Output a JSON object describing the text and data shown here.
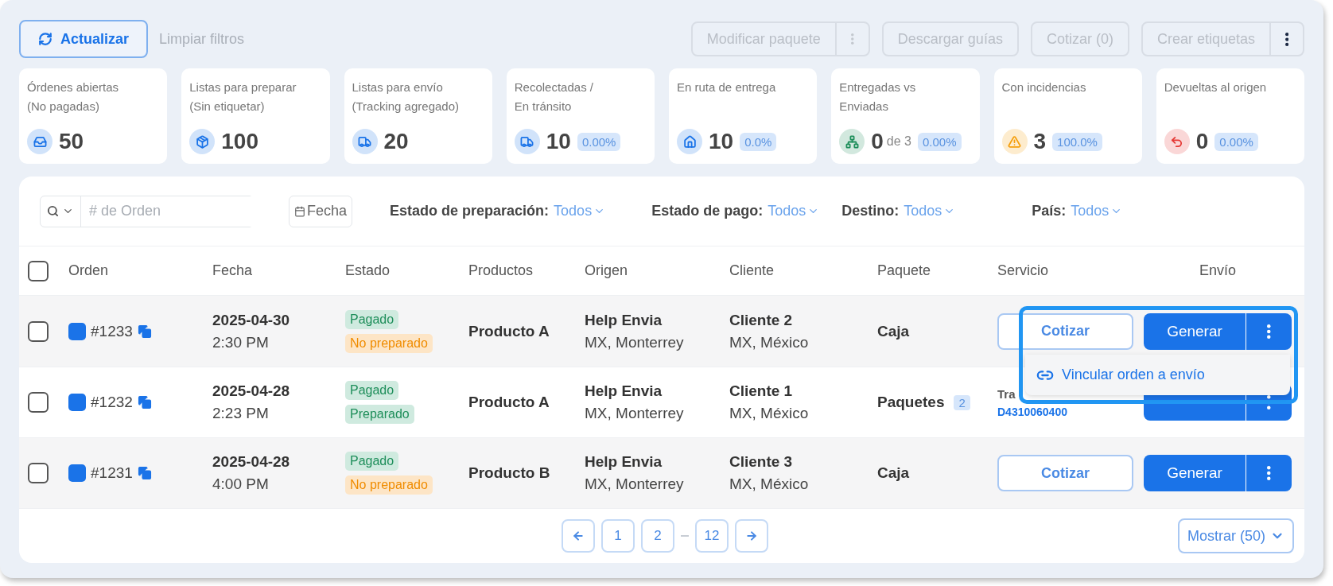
{
  "toolbar": {
    "refresh": "Actualizar",
    "clear": "Limpiar filtros",
    "actions": [
      {
        "label": "Modificar paquete",
        "disabled": true,
        "menu": {
          "disabled": true
        }
      },
      {
        "label": "Descargar guías",
        "disabled": true
      },
      {
        "label": "Cotizar (0)",
        "disabled": true
      },
      {
        "label": "Crear etiquetas",
        "disabled": true,
        "menu": {
          "disabled": false
        }
      }
    ]
  },
  "stats": [
    {
      "lines": [
        "Órdenes abiertas",
        "(No pagadas)"
      ],
      "value": "50",
      "color": "#1a73e8"
    },
    {
      "lines": [
        "Listas para preparar",
        "(Sin etiquetar)"
      ],
      "value": "100",
      "color": "#1a73e8"
    },
    {
      "lines": [
        "Listas para envío",
        "(Tracking agregado)"
      ],
      "value": "20",
      "color": "#1a73e8"
    },
    {
      "lines": [
        "Recolectadas /",
        "En tránsito"
      ],
      "value": "10",
      "badge": "0.00%",
      "color": "#1a73e8"
    },
    {
      "lines": [
        "En ruta de entrega"
      ],
      "value": "10",
      "badge": "0.0%",
      "color": "#1a73e8"
    },
    {
      "lines": [
        "Entregadas vs",
        "Enviadas"
      ],
      "value": "0",
      "of": "de 3",
      "badge": "0.00%",
      "color": "#1e8e5a"
    },
    {
      "lines": [
        "Con incidencias"
      ],
      "value": "3",
      "badge": "100.0%",
      "color": "#f59e0b"
    },
    {
      "lines": [
        "Devueltas al origen"
      ],
      "value": "0",
      "badge": "0.00%",
      "color": "#e53935"
    }
  ],
  "filters": {
    "search_placeholder": "# de Orden",
    "date": "Fecha",
    "selects": [
      {
        "label": "Estado de preparación:",
        "value": "Todos"
      },
      {
        "label": "Estado de pago:",
        "value": "Todos"
      },
      {
        "label": "Destino:",
        "value": "Todos"
      },
      {
        "label": "País:",
        "value": "Todos"
      }
    ]
  },
  "table": {
    "select_all": {
      "checked": false
    },
    "columns": [
      "Orden",
      "Fecha",
      "Estado",
      "Productos",
      "Origen",
      "Cliente",
      "Paquete",
      "Servicio",
      "Envío"
    ],
    "rows": [
      {
        "checked": false,
        "order": "#1233",
        "date": "2025-04-30",
        "time": "2:30 PM",
        "statuses": [
          {
            "label": "Pagado",
            "kind": "success"
          },
          {
            "label": "No preparado",
            "kind": "warning"
          }
        ],
        "product": "Producto A",
        "origin": "Help Envia",
        "origin_place": "MX, Monterrey",
        "client": "Cliente 2",
        "client_place": "MX, México",
        "package": "Caja",
        "service": {
          "kind": "quote",
          "label": "Cotizar"
        },
        "shipping": {
          "label": "Generar"
        }
      },
      {
        "checked": false,
        "order": "#1232",
        "date": "2025-04-28",
        "time": "2:23 PM",
        "statuses": [
          {
            "label": "Pagado",
            "kind": "success"
          },
          {
            "label": "Preparado",
            "kind": "success"
          }
        ],
        "product": "Producto A",
        "origin": "Help Envia",
        "origin_place": "MX, Monterrey",
        "client": "Cliente 1",
        "client_place": "MX, México",
        "package": "Paquetes",
        "package_count": "2",
        "service": {
          "kind": "tracking",
          "label": "Tra",
          "tracking": "D4310060400"
        },
        "shipping": {}
      },
      {
        "checked": false,
        "order": "#1231",
        "date": "2025-04-28",
        "time": "4:00 PM",
        "statuses": [
          {
            "label": "Pagado",
            "kind": "success"
          },
          {
            "label": "No preparado",
            "kind": "warning"
          }
        ],
        "product": "Producto B",
        "origin": "Help Envia",
        "origin_place": "MX, Monterrey",
        "client": "Cliente 3",
        "client_place": "MX, México",
        "package": "Caja",
        "service": {
          "kind": "quote",
          "label": "Cotizar"
        },
        "shipping": {
          "label": "Generar"
        }
      }
    ]
  },
  "menu": {
    "items": [
      "Vincular orden a envío"
    ]
  },
  "pagination": {
    "pages": [
      {
        "kind": "page",
        "label": "1"
      },
      {
        "kind": "page",
        "label": "2"
      },
      {
        "kind": "gap"
      },
      {
        "kind": "page",
        "label": "12"
      }
    ],
    "page_size": "Mostrar (50)"
  }
}
